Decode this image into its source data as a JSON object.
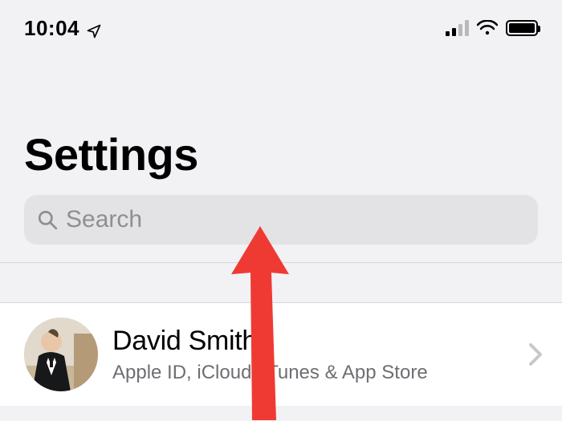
{
  "status": {
    "time": "10:04",
    "location_icon": "location-arrow",
    "cellular_bars_active": 2,
    "wifi": true,
    "battery_pct": 100
  },
  "page": {
    "title": "Settings"
  },
  "search": {
    "placeholder": "Search",
    "value": ""
  },
  "account": {
    "name": "David Smith",
    "subtitle": "Apple ID, iCloud, iTunes & App Store"
  },
  "annotation": {
    "arrow_color": "#ef3a34"
  }
}
